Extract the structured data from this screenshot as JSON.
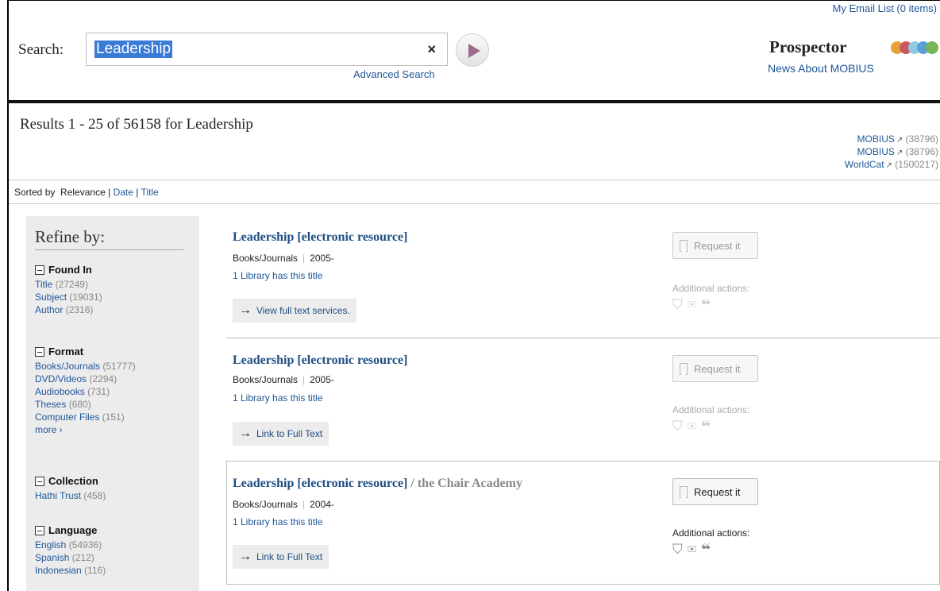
{
  "header": {
    "email_list": "My Email List (0 items)",
    "search_label": "Search:",
    "search_value": "Leadership",
    "clear_symbol": "×",
    "advanced_search": "Advanced Search",
    "brand": "Prospector",
    "brand_dot_colors": [
      "#e7a23b",
      "#c9595f",
      "#8ec9e6",
      "#5aa0d8",
      "#77b45a"
    ],
    "news_link": "News About MOBIUS"
  },
  "results_bar": {
    "title": "Results 1 - 25 of 56158 for Leadership",
    "external": [
      {
        "label": "MOBIUS",
        "count": "(38796)"
      },
      {
        "label": "MOBIUS",
        "count": "(38796)"
      },
      {
        "label": "WorldCat",
        "count": "(1500217)"
      }
    ]
  },
  "sort": {
    "prefix": "Sorted by",
    "current": "Relevance",
    "sep": "|",
    "options": [
      "Date",
      "Title"
    ]
  },
  "sidebar": {
    "title": "Refine by:",
    "groups": [
      {
        "label": "Found In",
        "items": [
          {
            "label": "Title",
            "count": "(27249)"
          },
          {
            "label": "Subject",
            "count": "(19031)"
          },
          {
            "label": "Author",
            "count": "(2316)"
          }
        ]
      },
      {
        "label": "Format",
        "items": [
          {
            "label": "Books/Journals",
            "count": "(51777)"
          },
          {
            "label": "DVD/Videos",
            "count": "(2294)"
          },
          {
            "label": "Audiobooks",
            "count": "(731)"
          },
          {
            "label": "Theses",
            "count": "(680)"
          },
          {
            "label": "Computer Files",
            "count": "(151)"
          }
        ],
        "more": "more ›"
      },
      {
        "label": "Collection",
        "items": [
          {
            "label": "Hathi Trust",
            "count": "(458)"
          }
        ]
      },
      {
        "label": "Language",
        "items": [
          {
            "label": "English",
            "count": "(54936)"
          },
          {
            "label": "Spanish",
            "count": "(212)"
          },
          {
            "label": "Indonesian",
            "count": "(116)"
          }
        ]
      }
    ]
  },
  "results": [
    {
      "title": "Leadership [electronic resource]",
      "author": "",
      "format": "Books/Journals",
      "date": "2005-",
      "libraries": "1 Library has this title",
      "action": "View full text services.",
      "request": "Request it",
      "additional": "Additional actions:"
    },
    {
      "title": "Leadership [electronic resource]",
      "author": "",
      "format": "Books/Journals",
      "date": "2005-",
      "libraries": "1 Library has this title",
      "action": "Link to Full Text",
      "request": "Request it",
      "additional": "Additional actions:"
    },
    {
      "title": "Leadership [electronic resource]",
      "author": " / the Chair Academy",
      "format": "Books/Journals",
      "date": "2004-",
      "libraries": "1 Library has this title",
      "action": "Link to Full Text",
      "request": "Request it",
      "additional": "Additional actions:"
    }
  ],
  "icons": {
    "arrow": "→",
    "basket": "⛉",
    "mail": "✉",
    "quote": "❝",
    "external": "↗"
  }
}
